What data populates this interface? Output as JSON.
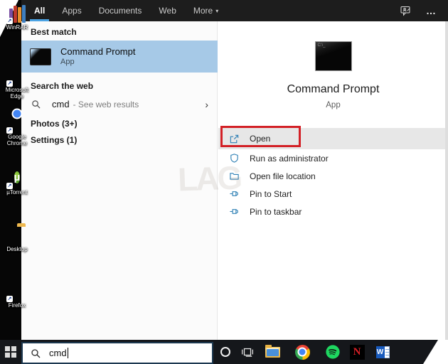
{
  "topbar": {
    "tabs": [
      {
        "label": "All",
        "active": true
      },
      {
        "label": "Apps",
        "active": false
      },
      {
        "label": "Documents",
        "active": false
      },
      {
        "label": "Web",
        "active": false
      },
      {
        "label": "More",
        "active": false,
        "dropdown": "▾"
      }
    ],
    "ellipsis": "…"
  },
  "left_panel": {
    "best_match_header": "Best match",
    "best_match": {
      "title": "Command Prompt",
      "subtitle": "App",
      "selected": true
    },
    "search_web_header": "Search the web",
    "web_result": {
      "query": "cmd",
      "hint": "- See web results",
      "chevron": "›"
    },
    "photos_header": "Photos (3+)",
    "settings_header": "Settings (1)"
  },
  "detail_panel": {
    "title": "Command Prompt",
    "subtitle": "App",
    "icon_hint": "C:\\_",
    "actions": [
      {
        "label": "Open",
        "icon": "open-launch-icon",
        "highlighted": true,
        "annotated": true
      },
      {
        "label": "Run as administrator",
        "icon": "shield-icon"
      },
      {
        "label": "Open file location",
        "icon": "folder-icon"
      },
      {
        "label": "Pin to Start",
        "icon": "pin-icon"
      },
      {
        "label": "Pin to taskbar",
        "icon": "pin-icon"
      }
    ]
  },
  "search_box": {
    "value": "cmd"
  },
  "taskbar": {
    "icons": [
      {
        "name": "cortana"
      },
      {
        "name": "task-view"
      },
      {
        "name": "file-explorer"
      },
      {
        "name": "chrome"
      },
      {
        "name": "spotify"
      },
      {
        "name": "netflix",
        "glyph": "N"
      },
      {
        "name": "word",
        "glyph": "W"
      }
    ]
  },
  "desktop_icons": [
    {
      "label": "WinRAR"
    },
    {
      "label": "Microsoft Edge"
    },
    {
      "label": "Google Chrome"
    },
    {
      "label": "µTorrent",
      "glyph": "µ"
    },
    {
      "label": "Desktop"
    },
    {
      "label": "Firefox"
    }
  ],
  "shortcut_arrow": "↗",
  "watermark": "LAG",
  "colors": {
    "accent_blue": "#4ba3e3",
    "selection_blue": "#a6c9e7",
    "annotation_red": "#d32026",
    "action_icon_blue": "#2f80b5",
    "taskbar_dark": "#15171b"
  }
}
